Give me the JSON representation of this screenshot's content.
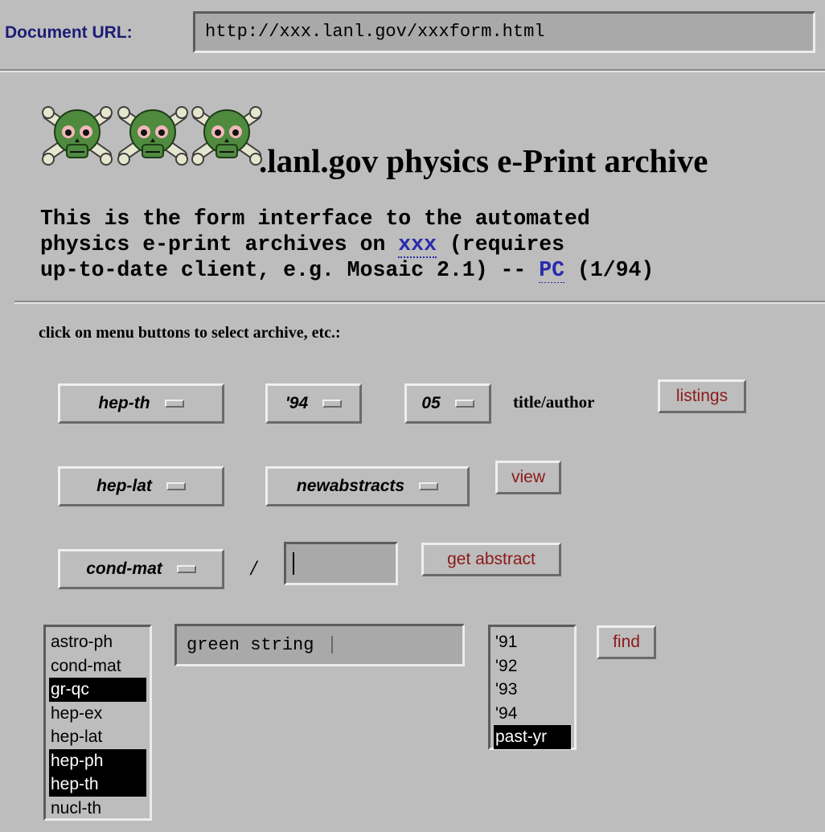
{
  "url_bar": {
    "label": "Document URL:",
    "value": "http://xxx.lanl.gov/xxxform.html"
  },
  "header": {
    "logo_icons": [
      "skull-crossbones-icon",
      "skull-crossbones-icon",
      "skull-crossbones-icon"
    ],
    "title": ".lanl.gov physics e-Print archive"
  },
  "intro": {
    "line1": "This is the form interface to the automated",
    "line2_pre": "physics e-print archives on ",
    "line2_link": "xxx",
    "line2_post": " (requires",
    "line3_pre": "up-to-date client, e.g. Mosaic 2.1) -- ",
    "line3_link": "PC",
    "line3_post": " (1/94)"
  },
  "instructions": "click on menu buttons to select archive, etc.:",
  "row1": {
    "archive_menu": "hep-th",
    "year_menu": "'94",
    "month_menu": "05",
    "label": "title/author",
    "button": "listings"
  },
  "row2": {
    "archive_menu": "hep-lat",
    "type_menu": "newabstracts",
    "button": "view"
  },
  "row3": {
    "archive_menu": "cond-mat",
    "separator": "/",
    "paper_number": "",
    "button": "get abstract"
  },
  "search": {
    "archive_list": [
      {
        "label": "astro-ph",
        "selected": false
      },
      {
        "label": "cond-mat",
        "selected": false
      },
      {
        "label": "gr-qc",
        "selected": true
      },
      {
        "label": "hep-ex",
        "selected": false
      },
      {
        "label": "hep-lat",
        "selected": false
      },
      {
        "label": "hep-ph",
        "selected": true
      },
      {
        "label": "hep-th",
        "selected": true
      },
      {
        "label": "nucl-th",
        "selected": false
      }
    ],
    "query": "green string",
    "year_list": [
      {
        "label": "'91",
        "selected": false
      },
      {
        "label": "'92",
        "selected": false
      },
      {
        "label": "'93",
        "selected": false
      },
      {
        "label": "'94",
        "selected": false
      },
      {
        "label": "past-yr",
        "selected": true
      }
    ],
    "button": "find"
  },
  "colors": {
    "background": "#bdbdbd",
    "field": "#a9a9a9",
    "button_text": "#8c1a1a",
    "link": "#2a2ab0",
    "url_label": "#1d1d75",
    "selection": "#000000"
  }
}
